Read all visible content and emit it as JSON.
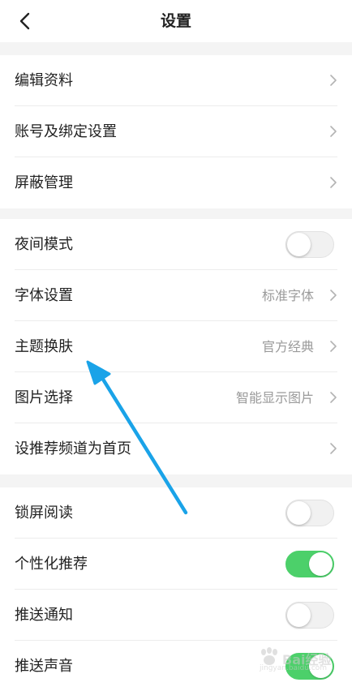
{
  "header": {
    "title": "设置",
    "back_icon": "chevron-left-icon"
  },
  "section1": {
    "items": [
      {
        "label": "编辑资料"
      },
      {
        "label": "账号及绑定设置"
      },
      {
        "label": "屏蔽管理"
      }
    ]
  },
  "section2": {
    "items": [
      {
        "label": "夜间模式",
        "toggle": false
      },
      {
        "label": "字体设置",
        "value": "标准字体"
      },
      {
        "label": "主题换肤",
        "value": "官方经典"
      },
      {
        "label": "图片选择",
        "value": "智能显示图片"
      },
      {
        "label": "设推荐频道为首页"
      }
    ]
  },
  "section3": {
    "items": [
      {
        "label": "锁屏阅读",
        "toggle": false
      },
      {
        "label": "个性化推荐",
        "toggle": true
      },
      {
        "label": "推送通知",
        "toggle": false
      },
      {
        "label": "推送声音",
        "toggle": true
      }
    ]
  },
  "colors": {
    "toggle_on": "#4cd06a",
    "arrow": "#1aa3e8"
  },
  "watermark": {
    "main": "Bai经验",
    "sub": "jingyan.baidu.com"
  }
}
